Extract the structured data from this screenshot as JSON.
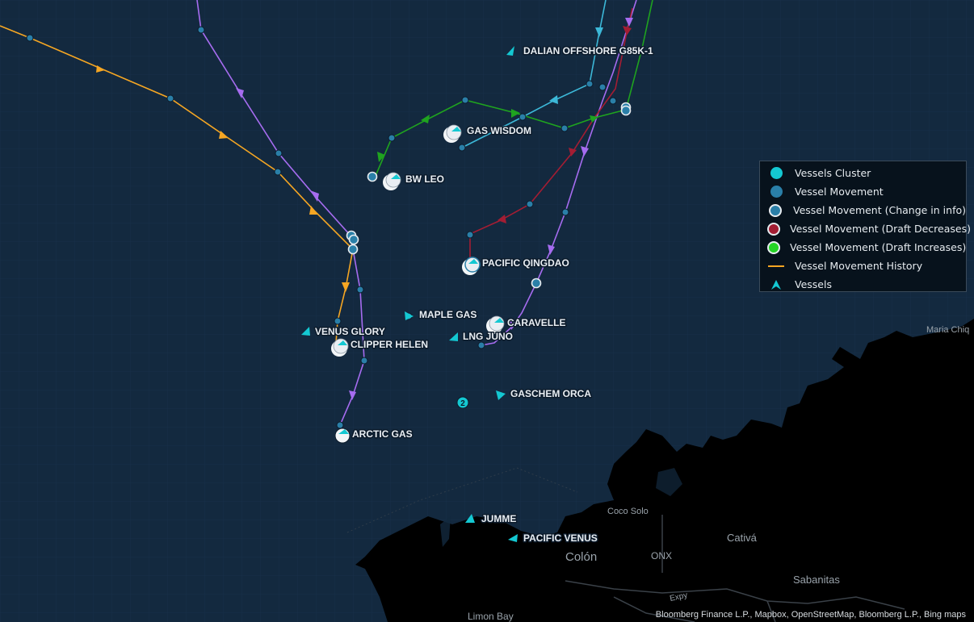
{
  "vessels": [
    {
      "name": "DALIAN OFFSHORE G85K-1"
    },
    {
      "name": "GAS WISDOM"
    },
    {
      "name": "BW LEO"
    },
    {
      "name": "PACIFIC QINGDAO"
    },
    {
      "name": "MAPLE GAS"
    },
    {
      "name": "CARAVELLE"
    },
    {
      "name": "VENUS GLORY"
    },
    {
      "name": "CLIPPER HELEN"
    },
    {
      "name": "LNG JUNO"
    },
    {
      "name": "GASCHEM ORCA"
    },
    {
      "name": "ARCTIC GAS"
    },
    {
      "name": "JUMME"
    },
    {
      "name": "PACIFIC VENUS"
    }
  ],
  "cluster": {
    "count": "2"
  },
  "places": {
    "maria_chiquita": "Maria Chiq",
    "coco_solo": "Coco Solo",
    "cativa": "Cativá",
    "colon": "Colón",
    "onx": "ONX",
    "sabanitas": "Sabanitas",
    "limon_bay": "Limon Bay",
    "expy": "Expy"
  },
  "legend": {
    "items": [
      {
        "label": "Vessels Cluster",
        "icon": "cluster-icon",
        "color": "#14c8d2"
      },
      {
        "label": "Vessel Movement",
        "icon": "movement-icon",
        "color": "#2a7fa8"
      },
      {
        "label": "Vessel Movement (Change in info)",
        "icon": "change-info-icon",
        "color": "#2a7fa8"
      },
      {
        "label": "Vessel Movement (Draft Decreases)",
        "icon": "draft-decrease-icon",
        "color": "#a31d33"
      },
      {
        "label": "Vessel Movement (Draft Increases)",
        "icon": "draft-increase-icon",
        "color": "#25d425"
      },
      {
        "label": "Vessel Movement History",
        "icon": "history-line-icon",
        "color": "#f5a623"
      },
      {
        "label": "Vessels",
        "icon": "vessel-arrow-icon",
        "color": "#14c8d2"
      }
    ]
  },
  "attribution": "Bloomberg Finance L.P., Mapbox, OpenStreetMap, Bloomberg L.P., Bing maps",
  "colors": {
    "water": "#13293f",
    "land": "#000000",
    "orange_track": "#f5a623",
    "purple_track": "#a66cf0",
    "green_track": "#1fa31f",
    "red_track": "#a31d33",
    "cyan_track": "#3cb8d8",
    "vessel": "#14c8d2"
  }
}
